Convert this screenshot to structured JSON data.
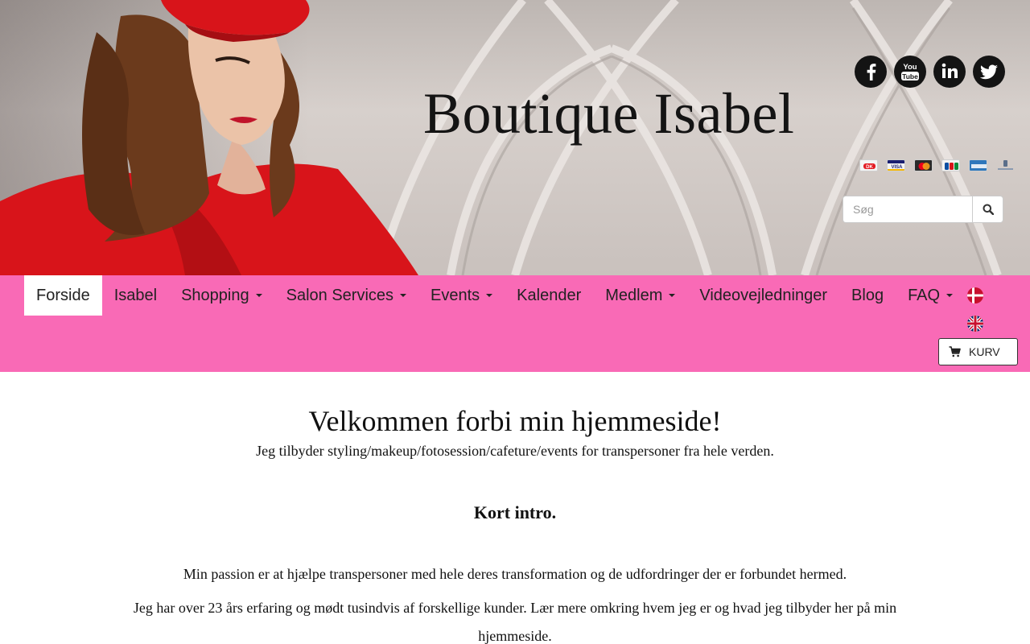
{
  "header": {
    "brand_title": "Boutique Isabel",
    "social": [
      {
        "name": "facebook-icon"
      },
      {
        "name": "youtube-icon",
        "label": "You Tube"
      },
      {
        "name": "linkedin-icon",
        "label": "in"
      },
      {
        "name": "twitter-icon"
      }
    ],
    "payment_methods": [
      "dankort",
      "visa",
      "mastercard",
      "jcb",
      "american-express",
      "mobilepay"
    ],
    "search": {
      "placeholder": "Søg"
    }
  },
  "nav": {
    "items": [
      {
        "label": "Forside",
        "active": true,
        "dropdown": false
      },
      {
        "label": "Isabel",
        "active": false,
        "dropdown": false
      },
      {
        "label": "Shopping",
        "active": false,
        "dropdown": true
      },
      {
        "label": "Salon Services",
        "active": false,
        "dropdown": true
      },
      {
        "label": "Events",
        "active": false,
        "dropdown": true
      },
      {
        "label": "Kalender",
        "active": false,
        "dropdown": false
      },
      {
        "label": "Medlem",
        "active": false,
        "dropdown": true
      },
      {
        "label": "Videovejledninger",
        "active": false,
        "dropdown": false
      },
      {
        "label": "Blog",
        "active": false,
        "dropdown": false
      },
      {
        "label": "FAQ",
        "active": false,
        "dropdown": true
      }
    ],
    "languages": [
      "danish-flag-icon",
      "uk-flag-icon"
    ],
    "cart_label": "KURV"
  },
  "main": {
    "welcome": "Velkommen forbi min hjemmeside!",
    "tagline": "Jeg tilbyder styling/makeup/fotosession/cafeture/events for transpersoner fra hele verden.",
    "intro_heading": "Kort intro.",
    "paragraph1": "Min passion er at hjælpe transpersoner med hele deres transformation og de udfordringer der er forbundet hermed.",
    "paragraph2": "Jeg har over 23 års erfaring og mødt tusindvis af forskellige kunder. Lær mere omkring hvem jeg er og hvad jeg tilbyder her på min hjemmeside."
  },
  "colors": {
    "nav_background": "#f96ab6",
    "banner_tone": "#cfc7c3",
    "text": "#111111"
  }
}
